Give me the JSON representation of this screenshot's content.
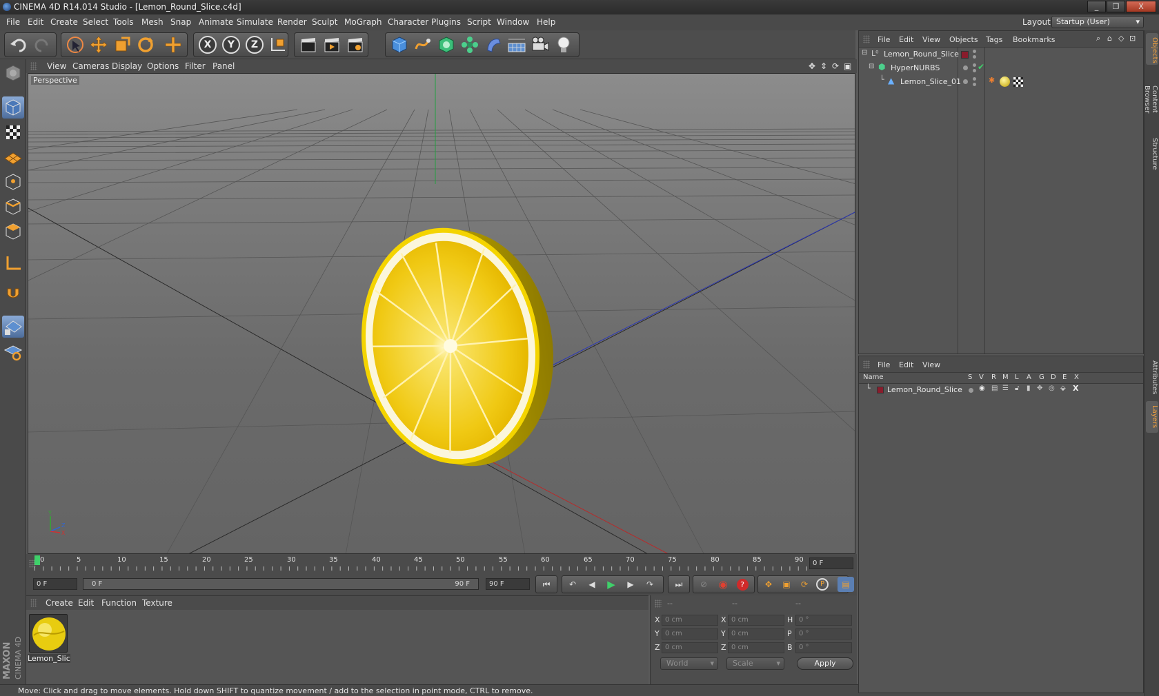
{
  "window": {
    "title": "CINEMA 4D R14.014 Studio - [Lemon_Round_Slice.c4d]",
    "controls": [
      "_",
      "❐",
      "X"
    ],
    "layout_label": "Layout:",
    "layout_value": "Startup (User)"
  },
  "menubar": {
    "items": [
      "File",
      "Edit",
      "Create",
      "Select",
      "Tools",
      "Mesh",
      "Snap",
      "Animate",
      "Simulate",
      "Render",
      "Sculpt",
      "MoGraph",
      "Character",
      "Plugins",
      "Script",
      "Window",
      "Help"
    ]
  },
  "toolbar": {
    "undo_icon": "undo-icon",
    "redo_icon": "redo-icon",
    "axis_labels": [
      "X",
      "Y",
      "Z"
    ]
  },
  "viewport": {
    "menu": [
      "View",
      "Cameras",
      "Display",
      "Options",
      "Filter",
      "Panel"
    ],
    "label": "Perspective",
    "axis_gizmo": {
      "y": "Y",
      "z": "Z",
      "x": "X"
    }
  },
  "timeline": {
    "ticks": [
      "0",
      "5",
      "10",
      "15",
      "20",
      "25",
      "30",
      "35",
      "40",
      "45",
      "50",
      "55",
      "60",
      "65",
      "70",
      "75",
      "80",
      "85",
      "90"
    ],
    "current_frame": "0 F",
    "start_field": "0 F",
    "range_start": "0 F",
    "range_end": "90 F",
    "end_field": "90 F"
  },
  "material_manager": {
    "menu": [
      "Create",
      "Edit",
      "Function",
      "Texture"
    ],
    "material_name": "Lemon_Slic"
  },
  "coordinates": {
    "headers": [
      "--",
      "--",
      "--"
    ],
    "rows": [
      {
        "pos_label": "X",
        "pos_value": "0 cm",
        "size_label": "X",
        "size_value": "0 cm",
        "rot_label": "H",
        "rot_value": "0 °"
      },
      {
        "pos_label": "Y",
        "pos_value": "0 cm",
        "size_label": "Y",
        "size_value": "0 cm",
        "rot_label": "P",
        "rot_value": "0 °"
      },
      {
        "pos_label": "Z",
        "pos_value": "0 cm",
        "size_label": "Z",
        "size_value": "0 cm",
        "rot_label": "B",
        "rot_value": "0 °"
      }
    ],
    "mode_select": "World",
    "type_select": "Scale",
    "apply_label": "Apply"
  },
  "object_manager": {
    "menu": [
      "File",
      "Edit",
      "View",
      "Objects",
      "Tags",
      "Bookmarks"
    ],
    "objects": [
      {
        "name": "Lemon_Round_Slice",
        "indent": 0
      },
      {
        "name": "HyperNURBS",
        "indent": 1
      },
      {
        "name": "Lemon_Slice_01",
        "indent": 2
      }
    ]
  },
  "layer_manager": {
    "menu": [
      "File",
      "Edit",
      "View"
    ],
    "columns": [
      "Name",
      "S",
      "V",
      "R",
      "M",
      "L",
      "A",
      "G",
      "D",
      "E",
      "X"
    ],
    "layers": [
      {
        "name": "Lemon_Round_Slice"
      }
    ]
  },
  "right_tabs": [
    "Objects",
    "Content Browser",
    "Structure",
    "Attributes",
    "Layers"
  ],
  "status_text": "Move: Click and drag to move elements. Hold down SHIFT to quantize movement / add to the selection in point mode, CTRL to remove.",
  "logo": {
    "maxon": "MAXON",
    "cinema": "CINEMA 4D"
  },
  "colors": {
    "accent_orange": "#f0a030",
    "selection_blue": "#5b7fb3",
    "layer_color": "#8a1c2c",
    "lemon_yellow": "#f2d21a"
  }
}
